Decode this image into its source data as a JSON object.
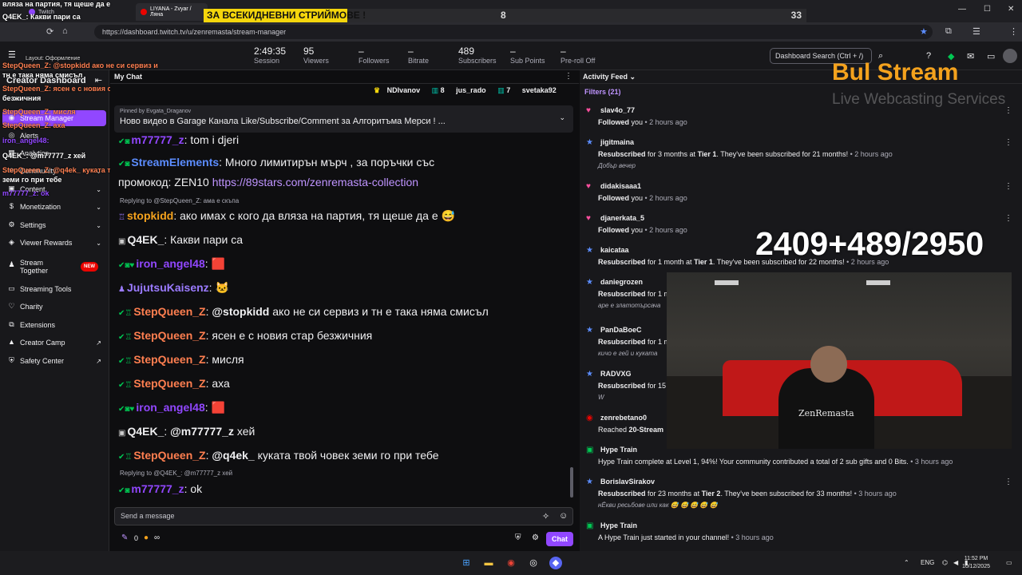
{
  "browser": {
    "tab1_label": "Twitch",
    "tab2_label": "LIYANA - Zvyar / Ляна",
    "url": "https://dashboard.twitch.tv/u/zenremasta/stream-manager",
    "minimize": "—",
    "maximize": "☐",
    "close": "✕"
  },
  "banner": {
    "text": "ЗА ВСЕКИДНЕВНИ СТРИЙМОВЕ !",
    "num1": "8",
    "num2": "33"
  },
  "stats": [
    {
      "value": "2:49:35",
      "label": "Session"
    },
    {
      "value": "95",
      "label": "Viewers"
    },
    {
      "value": "–",
      "label": "Followers"
    },
    {
      "value": "–",
      "label": "Bitrate"
    },
    {
      "value": "489",
      "label": "Subscribers"
    },
    {
      "value": "–",
      "label": "Sub Points"
    },
    {
      "value": "–",
      "label": "Pre-roll Off"
    }
  ],
  "dashboard_search": "Dashboard Search (Ctrl + /)",
  "sidebar": {
    "title": "Creator Dashboard",
    "items": [
      {
        "label": "Stream Manager"
      },
      {
        "label": "Alerts"
      },
      {
        "label": "Analytics"
      },
      {
        "label": "Community"
      },
      {
        "label": "Content"
      },
      {
        "label": "Monetization"
      },
      {
        "label": "Settings"
      },
      {
        "label": "Viewer Rewards"
      },
      {
        "label": "Stream Together",
        "badge": "NEW"
      },
      {
        "label": "Streaming Tools"
      },
      {
        "label": "Charity"
      },
      {
        "label": "Extensions"
      },
      {
        "label": "Creator Camp"
      },
      {
        "label": "Safety Center"
      }
    ],
    "layout_label": "Layout: Оформление"
  },
  "overlay_chat": [
    "вляза на партия, тя щеше да е",
    "Q4EK_: Какви пари са",
    "StepQueen_Z: @stopkidd ако не си сервиз и",
    "тн е така няма смисъл",
    "StepQueen_Z: ясен е с новия стар",
    "безжичния",
    "StepQueen_Z: мисля",
    "StepQueen_Z: аха",
    "iron_angel48:",
    "Q4EK_: @m77777_z хей",
    "StepQueen_Z: @q4ek_ куката твой човек",
    "земи го при тебе",
    "m77777_z: ok"
  ],
  "chat": {
    "header": "My Chat",
    "leaderboard": [
      {
        "name": "NDIvanov",
        "count": ""
      },
      {
        "name": "jus_rado",
        "count": "8"
      },
      {
        "name": "svetaka92",
        "count": "7"
      }
    ],
    "pinned_by": "Pinned by Evgata_Draganov",
    "pinned_msg": "Ново видео в Garage Канала Like/Subscribe/Comment за Алгоритъма Мерси ! ...",
    "messages": [
      {
        "user": "m77777_z",
        "color": "#9147ff",
        "text": ": tom i djeri"
      },
      {
        "user": "StreamElements",
        "color": "#5c8dff",
        "text": ": Много лимитирън мърч , за поръчки със"
      },
      {
        "user": "",
        "color": "#efeff1",
        "text": "промокод: ZEN10 ",
        "link": "https://89stars.com/zenremasta-collection"
      },
      {
        "reply": "Replying to @StepQueen_Z: ама е скъпа"
      },
      {
        "user": "stopkidd",
        "color": "#f4a21d",
        "text": ": ако имах с кого да вляза на партия, тя щеше да е 😅"
      },
      {
        "user": "Q4EK_",
        "color": "#efeff1",
        "text": ": Какви пари са"
      },
      {
        "user": "iron_angel48",
        "color": "#9147ff",
        "text": ": 🟥"
      },
      {
        "user": "JujutsuKaisenz",
        "color": "#9b7bff",
        "text": ": 🐱"
      },
      {
        "user": "StepQueen_Z",
        "color": "#ff7f50",
        "mention": "@stopkidd",
        "text": " ако не си сервиз и тн е така няма смисъл"
      },
      {
        "user": "StepQueen_Z",
        "color": "#ff7f50",
        "text": ": ясен е с новия стар безжичния"
      },
      {
        "user": "StepQueen_Z",
        "color": "#ff7f50",
        "text": ": мисля"
      },
      {
        "user": "StepQueen_Z",
        "color": "#ff7f50",
        "text": ": аха"
      },
      {
        "user": "iron_angel48",
        "color": "#9147ff",
        "text": ": 🟥"
      },
      {
        "user": "Q4EK_",
        "color": "#efeff1",
        "mention": "@m77777_z",
        "text": " хей"
      },
      {
        "user": "StepQueen_Z",
        "color": "#ff7f50",
        "mention": "@q4ek_",
        "text": " куката твой човек земи го при тебе"
      },
      {
        "reply": "Replying to @Q4EK_: @m77777_z хей"
      },
      {
        "user": "m77777_z",
        "color": "#9147ff",
        "text": ": ok"
      }
    ],
    "input_placeholder": "Send a message",
    "points": "0",
    "infinite": "∞",
    "chat_button": "Chat"
  },
  "feed": {
    "header": "Activity Feed",
    "filters": "Filters (21)",
    "items": [
      {
        "icon": "heart",
        "name": "slav4o_77",
        "desc_bold": "Followed",
        "desc": " you",
        "time": " • 2 hours ago"
      },
      {
        "icon": "star",
        "name": "jigitmaina",
        "desc_bold": "Resubscribed",
        "desc": " for 3 months at ",
        "tier": "Tier 1",
        "desc2": ". They've been subscribed for 21 months!",
        "time": " • 2 hours ago",
        "note": "Добър вечер"
      },
      {
        "icon": "heart",
        "name": "didakisaaa1",
        "desc_bold": "Followed",
        "desc": " you",
        "time": " • 2 hours ago"
      },
      {
        "icon": "heart",
        "name": "djanerkata_5",
        "desc_bold": "Followed",
        "desc": " you",
        "time": " • 2 hours ago"
      },
      {
        "icon": "star",
        "name": "kaicataa",
        "desc_bold": "Resubscribed",
        "desc": " for 1 month at ",
        "tier": "Tier 1",
        "desc2": ". They've been subscribed for 22 months!",
        "time": " • 2 hours ago"
      },
      {
        "icon": "star",
        "name": "daniegrozen",
        "desc_bold": "Resubscribed",
        "desc": " for 1 m",
        "time": "",
        "note": "аре е златотърсача"
      },
      {
        "icon": "star",
        "name": "PanDaBoeC",
        "desc_bold": "Resubscribed",
        "desc": " for 1 m",
        "time": "",
        "note": "кичо е гей и куката"
      },
      {
        "icon": "star",
        "name": "RADVXG",
        "desc_bold": "Resubscribed",
        "desc": " for 15",
        "time": "",
        "note": "W"
      },
      {
        "icon": "stream",
        "name": "zenrebetano0",
        "desc_bold": "",
        "desc": "Reached ",
        "tier": "20-Stream",
        "time": ""
      },
      {
        "icon": "train",
        "name": "Hype Train",
        "desc_bold": "",
        "desc": "Hype Train complete at Level 1, 94%! Your community contributed a total of 2 sub gifts and 0 Bits.",
        "time": " • 3 hours ago"
      },
      {
        "icon": "star",
        "name": "BorislavSirakov",
        "desc_bold": "Resubscribed",
        "desc": " for 23 months at ",
        "tier": "Tier 2",
        "desc2": ". They've been subscribed for 33 months!",
        "time": " • 3 hours ago",
        "note": "нЁкви ресьбове или как 😅 😅 😅 😅 😅"
      },
      {
        "icon": "train",
        "name": "Hype Train",
        "desc_bold": "",
        "desc": "A Hype Train just started in your channel!",
        "time": " • 3 hours ago"
      }
    ]
  },
  "overlay": {
    "counter": "2409+489/2950",
    "logo_main": "Bul Stream",
    "logo_sub": "Live Webcasting Services",
    "shirt": "ZenRemasta"
  },
  "taskbar": {
    "lang": "ENG",
    "time": "11:52 PM",
    "date": "10/12/2025"
  },
  "colors": {
    "accent": "#9147ff",
    "banner_yellow": "#f5d60c",
    "logo_orange": "#f4a21d"
  }
}
